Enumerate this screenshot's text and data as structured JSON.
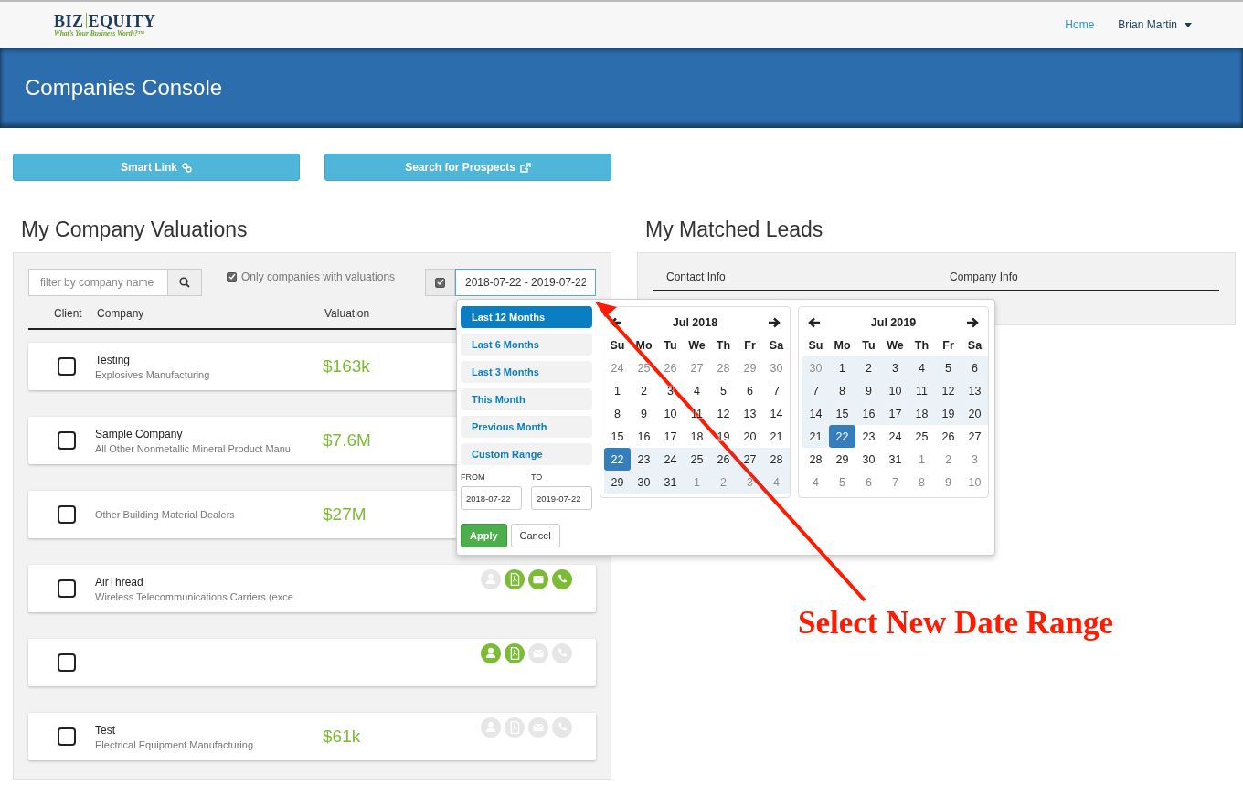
{
  "header": {
    "logo": {
      "left": "BIZ",
      "right": "EQUITY",
      "tagline": "What’s Your Business Worth?™"
    },
    "nav": [
      {
        "label": "Home",
        "kind": "link"
      },
      {
        "label": "Brian Martin",
        "kind": "dropdown"
      }
    ]
  },
  "banner": {
    "title": "Companies Console"
  },
  "actions": [
    {
      "label": "Smart Link",
      "kind": "link"
    },
    {
      "label": "Search for Prospects",
      "kind": "external"
    }
  ],
  "valuations": {
    "title": "My Company Valuations",
    "search": {
      "placeholder": "filter by company name"
    },
    "only_valued": {
      "label": "Only companies with valuations",
      "checked": true
    },
    "date_filter": {
      "checked": true,
      "value": "2018-07-22 - 2019-07-22"
    },
    "columns": [
      "Client",
      "Company",
      "Valuation"
    ],
    "rows": [
      {
        "checked": false,
        "name": "Testing",
        "industry": "Explosives Manufacturing",
        "valuation": "$163k"
      },
      {
        "checked": false,
        "name": "Sample Company",
        "industry": "All Other Nonmetallic Mineral Product Manu",
        "valuation": "$7.6M"
      },
      {
        "checked": false,
        "industry": "Other Building Material Dealers",
        "valuation": "$27M"
      },
      {
        "checked": false,
        "name": "AirThread",
        "industry": "Wireless Telecommunications Carriers (exce",
        "actions": [
          {
            "kind": "user",
            "active": false
          },
          {
            "kind": "pdf",
            "active": true
          },
          {
            "kind": "mail",
            "active": true
          },
          {
            "kind": "phone",
            "active": true
          }
        ]
      },
      {
        "checked": false,
        "actions": [
          {
            "kind": "user",
            "active": true
          },
          {
            "kind": "pdf",
            "active": true
          },
          {
            "kind": "mail",
            "active": false
          },
          {
            "kind": "phone",
            "active": false
          }
        ]
      },
      {
        "checked": false,
        "name": "Test",
        "industry": "Electrical Equipment Manufacturing",
        "valuation": "$61k",
        "actions": [
          {
            "kind": "user",
            "active": false
          },
          {
            "kind": "pdf",
            "active": false
          },
          {
            "kind": "mail",
            "active": false
          },
          {
            "kind": "phone",
            "active": false
          }
        ]
      }
    ]
  },
  "leads": {
    "title": "My Matched Leads",
    "columns": [
      "Contact Info",
      "Company Info"
    ]
  },
  "date_picker": {
    "ranges": [
      {
        "label": "Last 12 Months",
        "selected": true
      },
      {
        "label": "Last 6 Months",
        "selected": false
      },
      {
        "label": "Last 3 Months",
        "selected": false
      },
      {
        "label": "This Month",
        "selected": false
      },
      {
        "label": "Previous Month",
        "selected": false
      },
      {
        "label": "Custom Range",
        "selected": false
      }
    ],
    "from": {
      "label": "FROM",
      "value": "2018-07-22"
    },
    "to": {
      "label": "TO",
      "value": "2019-07-22"
    },
    "buttons": [
      {
        "label": "Apply",
        "kind": "primary"
      },
      {
        "label": "Cancel",
        "kind": "default"
      }
    ],
    "calendars": [
      {
        "month": "Jul 2018",
        "weekdays": [
          "Su",
          "Mo",
          "Tu",
          "We",
          "Th",
          "Fr",
          "Sa"
        ],
        "weeks": [
          [
            {
              "d": "24",
              "off": true,
              "in_range": false,
              "selected": false
            },
            {
              "d": "25",
              "off": true,
              "in_range": false,
              "selected": false
            },
            {
              "d": "26",
              "off": true,
              "in_range": false,
              "selected": false
            },
            {
              "d": "27",
              "off": true,
              "in_range": false,
              "selected": false
            },
            {
              "d": "28",
              "off": true,
              "in_range": false,
              "selected": false
            },
            {
              "d": "29",
              "off": true,
              "in_range": false,
              "selected": false
            },
            {
              "d": "30",
              "off": true,
              "in_range": false,
              "selected": false
            }
          ],
          [
            {
              "d": "1",
              "off": false,
              "in_range": false,
              "selected": false
            },
            {
              "d": "2",
              "off": false,
              "in_range": false,
              "selected": false
            },
            {
              "d": "3",
              "off": false,
              "in_range": false,
              "selected": false
            },
            {
              "d": "4",
              "off": false,
              "in_range": false,
              "selected": false
            },
            {
              "d": "5",
              "off": false,
              "in_range": false,
              "selected": false
            },
            {
              "d": "6",
              "off": false,
              "in_range": false,
              "selected": false
            },
            {
              "d": "7",
              "off": false,
              "in_range": false,
              "selected": false
            }
          ],
          [
            {
              "d": "8",
              "off": false,
              "in_range": false,
              "selected": false
            },
            {
              "d": "9",
              "off": false,
              "in_range": false,
              "selected": false
            },
            {
              "d": "10",
              "off": false,
              "in_range": false,
              "selected": false
            },
            {
              "d": "11",
              "off": false,
              "in_range": false,
              "selected": false
            },
            {
              "d": "12",
              "off": false,
              "in_range": false,
              "selected": false
            },
            {
              "d": "13",
              "off": false,
              "in_range": false,
              "selected": false
            },
            {
              "d": "14",
              "off": false,
              "in_range": false,
              "selected": false
            }
          ],
          [
            {
              "d": "15",
              "off": false,
              "in_range": false,
              "selected": false
            },
            {
              "d": "16",
              "off": false,
              "in_range": false,
              "selected": false
            },
            {
              "d": "17",
              "off": false,
              "in_range": false,
              "selected": false
            },
            {
              "d": "18",
              "off": false,
              "in_range": false,
              "selected": false
            },
            {
              "d": "19",
              "off": false,
              "in_range": false,
              "selected": false
            },
            {
              "d": "20",
              "off": false,
              "in_range": false,
              "selected": false
            },
            {
              "d": "21",
              "off": false,
              "in_range": false,
              "selected": false
            }
          ],
          [
            {
              "d": "22",
              "off": false,
              "in_range": true,
              "selected": true
            },
            {
              "d": "23",
              "off": false,
              "in_range": true,
              "selected": false
            },
            {
              "d": "24",
              "off": false,
              "in_range": true,
              "selected": false
            },
            {
              "d": "25",
              "off": false,
              "in_range": true,
              "selected": false
            },
            {
              "d": "26",
              "off": false,
              "in_range": true,
              "selected": false
            },
            {
              "d": "27",
              "off": false,
              "in_range": true,
              "selected": false
            },
            {
              "d": "28",
              "off": false,
              "in_range": true,
              "selected": false
            }
          ],
          [
            {
              "d": "29",
              "off": false,
              "in_range": true,
              "selected": false
            },
            {
              "d": "30",
              "off": false,
              "in_range": true,
              "selected": false
            },
            {
              "d": "31",
              "off": false,
              "in_range": true,
              "selected": false
            },
            {
              "d": "1",
              "off": true,
              "in_range": true,
              "selected": false
            },
            {
              "d": "2",
              "off": true,
              "in_range": true,
              "selected": false
            },
            {
              "d": "3",
              "off": true,
              "in_range": true,
              "selected": false
            },
            {
              "d": "4",
              "off": true,
              "in_range": true,
              "selected": false
            }
          ]
        ]
      },
      {
        "month": "Jul 2019",
        "weekdays": [
          "Su",
          "Mo",
          "Tu",
          "We",
          "Th",
          "Fr",
          "Sa"
        ],
        "weeks": [
          [
            {
              "d": "30",
              "off": true,
              "in_range": true,
              "selected": false
            },
            {
              "d": "1",
              "off": false,
              "in_range": true,
              "selected": false
            },
            {
              "d": "2",
              "off": false,
              "in_range": true,
              "selected": false
            },
            {
              "d": "3",
              "off": false,
              "in_range": true,
              "selected": false
            },
            {
              "d": "4",
              "off": false,
              "in_range": true,
              "selected": false
            },
            {
              "d": "5",
              "off": false,
              "in_range": true,
              "selected": false
            },
            {
              "d": "6",
              "off": false,
              "in_range": true,
              "selected": false
            }
          ],
          [
            {
              "d": "7",
              "off": false,
              "in_range": true,
              "selected": false
            },
            {
              "d": "8",
              "off": false,
              "in_range": true,
              "selected": false
            },
            {
              "d": "9",
              "off": false,
              "in_range": true,
              "selected": false
            },
            {
              "d": "10",
              "off": false,
              "in_range": true,
              "selected": false
            },
            {
              "d": "11",
              "off": false,
              "in_range": true,
              "selected": false
            },
            {
              "d": "12",
              "off": false,
              "in_range": true,
              "selected": false
            },
            {
              "d": "13",
              "off": false,
              "in_range": true,
              "selected": false
            }
          ],
          [
            {
              "d": "14",
              "off": false,
              "in_range": true,
              "selected": false
            },
            {
              "d": "15",
              "off": false,
              "in_range": true,
              "selected": false
            },
            {
              "d": "16",
              "off": false,
              "in_range": true,
              "selected": false
            },
            {
              "d": "17",
              "off": false,
              "in_range": true,
              "selected": false
            },
            {
              "d": "18",
              "off": false,
              "in_range": true,
              "selected": false
            },
            {
              "d": "19",
              "off": false,
              "in_range": true,
              "selected": false
            },
            {
              "d": "20",
              "off": false,
              "in_range": true,
              "selected": false
            }
          ],
          [
            {
              "d": "21",
              "off": false,
              "in_range": true,
              "selected": false
            },
            {
              "d": "22",
              "off": false,
              "in_range": true,
              "selected": true
            },
            {
              "d": "23",
              "off": false,
              "in_range": false,
              "selected": false
            },
            {
              "d": "24",
              "off": false,
              "in_range": false,
              "selected": false
            },
            {
              "d": "25",
              "off": false,
              "in_range": false,
              "selected": false
            },
            {
              "d": "26",
              "off": false,
              "in_range": false,
              "selected": false
            },
            {
              "d": "27",
              "off": false,
              "in_range": false,
              "selected": false
            }
          ],
          [
            {
              "d": "28",
              "off": false,
              "in_range": false,
              "selected": false
            },
            {
              "d": "29",
              "off": false,
              "in_range": false,
              "selected": false
            },
            {
              "d": "30",
              "off": false,
              "in_range": false,
              "selected": false
            },
            {
              "d": "31",
              "off": false,
              "in_range": false,
              "selected": false
            },
            {
              "d": "1",
              "off": true,
              "in_range": false,
              "selected": false
            },
            {
              "d": "2",
              "off": true,
              "in_range": false,
              "selected": false
            },
            {
              "d": "3",
              "off": true,
              "in_range": false,
              "selected": false
            }
          ],
          [
            {
              "d": "4",
              "off": true,
              "in_range": false,
              "selected": false
            },
            {
              "d": "5",
              "off": true,
              "in_range": false,
              "selected": false
            },
            {
              "d": "6",
              "off": true,
              "in_range": false,
              "selected": false
            },
            {
              "d": "7",
              "off": true,
              "in_range": false,
              "selected": false
            },
            {
              "d": "8",
              "off": true,
              "in_range": false,
              "selected": false
            },
            {
              "d": "9",
              "off": true,
              "in_range": false,
              "selected": false
            },
            {
              "d": "10",
              "off": true,
              "in_range": false,
              "selected": false
            }
          ]
        ]
      }
    ]
  },
  "annotation": {
    "text": "Select New Date Range"
  }
}
